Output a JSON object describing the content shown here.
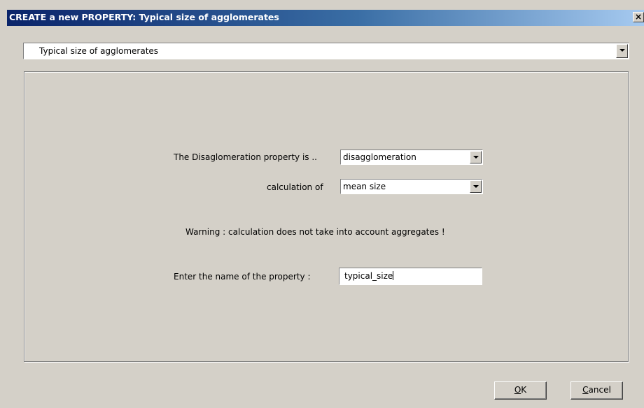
{
  "window": {
    "title": "CREATE a new PROPERTY: Typical size of agglomerates",
    "close_symbol": "×"
  },
  "property_select": {
    "selected": "Typical size of agglomerates"
  },
  "form": {
    "disaglomeration_label": "The Disaglomeration property is ..",
    "disaglomeration_value": "disagglomeration",
    "calculation_label": "calculation of",
    "calculation_value": "mean size",
    "warning": "Warning : calculation does not take into account aggregates !",
    "name_label": "Enter the name of the property :",
    "name_value": "typical_size"
  },
  "buttons": {
    "ok_mnemonic": "O",
    "ok_rest": "K",
    "cancel_mnemonic": "C",
    "cancel_rest": "ancel"
  },
  "colors": {
    "dialog_bg": "#d4d0c8",
    "titlebar_start": "#0a246a",
    "titlebar_end": "#a6caf0"
  }
}
